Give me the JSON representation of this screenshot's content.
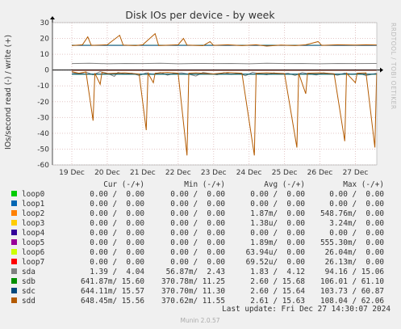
{
  "chart_data": {
    "type": "line",
    "title": "Disk IOs per device - by week",
    "ylabel": "IOs/second read (-) / write (+)",
    "ylim": [
      -60,
      30
    ],
    "yticks": [
      30,
      20,
      10,
      0,
      -10,
      -20,
      -30,
      -40,
      -50,
      -60
    ],
    "xlim": [
      "2024-12-19T00:00",
      "2024-12-27T14:30"
    ],
    "xticks": [
      {
        "label": "19 Dec",
        "time": "2024-12-19T00:00"
      },
      {
        "label": "20 Dec",
        "time": "2024-12-20T00:00"
      },
      {
        "label": "21 Dec",
        "time": "2024-12-21T00:00"
      },
      {
        "label": "22 Dec",
        "time": "2024-12-22T00:00"
      },
      {
        "label": "23 Dec",
        "time": "2024-12-23T00:00"
      },
      {
        "label": "24 Dec",
        "time": "2024-12-24T00:00"
      },
      {
        "label": "25 Dec",
        "time": "2024-12-25T00:00"
      },
      {
        "label": "26 Dec",
        "time": "2024-12-26T00:00"
      },
      {
        "label": "27 Dec",
        "time": "2024-12-27T00:00"
      }
    ],
    "grid": true,
    "legend_placement": "bottom",
    "series": [
      {
        "name": "loop0",
        "color": "#00cc00",
        "write_avg": 0,
        "read_avg": 0
      },
      {
        "name": "loop1",
        "color": "#0066b3",
        "write_avg": 0,
        "read_avg": 0
      },
      {
        "name": "loop2",
        "color": "#ff8000",
        "write_avg": 0,
        "read_avg": 0.00187
      },
      {
        "name": "loop3",
        "color": "#ffcc00",
        "write_avg": 0,
        "read_avg": 1.38e-06
      },
      {
        "name": "loop4",
        "color": "#330099",
        "write_avg": 0,
        "read_avg": 0
      },
      {
        "name": "loop5",
        "color": "#990099",
        "write_avg": 0,
        "read_avg": 0.00189
      },
      {
        "name": "loop6",
        "color": "#ccff00",
        "write_avg": 0,
        "read_avg": 6.394e-05
      },
      {
        "name": "loop7",
        "color": "#ff0000",
        "write_avg": 0,
        "read_avg": 6.952e-05
      },
      {
        "name": "sda",
        "color": "#808080",
        "write_avg": 4.12,
        "read_avg": 1.83,
        "write_points": [
          [
            0,
            4.1
          ],
          [
            0.5,
            4.3
          ],
          [
            1,
            4.0
          ],
          [
            1.5,
            4.2
          ],
          [
            2,
            4.1
          ],
          [
            2.5,
            4.3
          ],
          [
            3,
            4.0
          ],
          [
            3.5,
            4.2
          ],
          [
            4,
            4.1
          ],
          [
            4.5,
            4.2
          ],
          [
            5,
            4.0
          ],
          [
            5.5,
            4.3
          ],
          [
            6,
            4.1
          ],
          [
            6.5,
            4.2
          ],
          [
            7,
            4.0
          ],
          [
            7.5,
            4.2
          ],
          [
            8,
            4.1
          ],
          [
            8.6,
            4.2
          ]
        ],
        "read_points": [
          [
            0,
            -1.5
          ],
          [
            0.2,
            -2.5
          ],
          [
            0.4,
            -1.2
          ],
          [
            0.6,
            -3.0
          ],
          [
            0.8,
            -1.0
          ],
          [
            1,
            -2.0
          ],
          [
            1.2,
            -4.0
          ],
          [
            1.3,
            -1.5
          ],
          [
            1.5,
            -2.5
          ],
          [
            1.7,
            -2.0
          ],
          [
            1.9,
            -3.5
          ],
          [
            2.1,
            -1.8
          ],
          [
            2.3,
            -2.8
          ],
          [
            2.5,
            -1.5
          ],
          [
            2.7,
            -3.2
          ],
          [
            2.9,
            -2.0
          ],
          [
            3.1,
            -1.8
          ],
          [
            3.3,
            -2.6
          ],
          [
            3.5,
            -3.8
          ],
          [
            3.7,
            -1.5
          ],
          [
            3.9,
            -2.2
          ],
          [
            4.1,
            -3.0
          ],
          [
            4.3,
            -1.6
          ],
          [
            4.5,
            -2.8
          ],
          [
            4.7,
            -2.0
          ],
          [
            4.9,
            -3.6
          ],
          [
            5.1,
            -1.4
          ],
          [
            5.3,
            -2.4
          ],
          [
            5.5,
            -3.0
          ],
          [
            5.7,
            -1.8
          ],
          [
            5.9,
            -2.6
          ],
          [
            6.1,
            -2.0
          ],
          [
            6.3,
            -3.4
          ],
          [
            6.5,
            -1.6
          ],
          [
            6.7,
            -2.5
          ],
          [
            6.9,
            -3.1
          ],
          [
            7.1,
            -1.7
          ],
          [
            7.3,
            -2.4
          ],
          [
            7.5,
            -3.3
          ],
          [
            7.7,
            -1.9
          ],
          [
            7.9,
            -2.7
          ],
          [
            8.1,
            -2.0
          ],
          [
            8.3,
            -3.5
          ],
          [
            8.6,
            -2.0
          ]
        ]
      },
      {
        "name": "sdb",
        "color": "#008f00",
        "write_avg": 15.68,
        "read_avg": 2.6
      },
      {
        "name": "sdc",
        "color": "#00487d",
        "write_avg": 15.64,
        "read_avg": 2.6
      },
      {
        "name": "sdd",
        "color": "#b35a00",
        "write_avg": 15.63,
        "read_avg": 2.61,
        "write_points": [
          [
            0,
            15.5
          ],
          [
            0.3,
            16
          ],
          [
            0.45,
            21
          ],
          [
            0.55,
            15.6
          ],
          [
            1,
            16
          ],
          [
            1.35,
            22
          ],
          [
            1.45,
            15.8
          ],
          [
            1.8,
            15.5
          ],
          [
            2,
            16
          ],
          [
            2.35,
            23
          ],
          [
            2.45,
            15.5
          ],
          [
            3,
            16
          ],
          [
            3.15,
            20
          ],
          [
            3.25,
            15.8
          ],
          [
            3.7,
            15.4
          ],
          [
            3.9,
            18
          ],
          [
            4,
            15.6
          ],
          [
            4.4,
            16
          ],
          [
            4.8,
            15.5
          ],
          [
            5.2,
            16
          ],
          [
            5.5,
            15.2
          ],
          [
            5.9,
            15.8
          ],
          [
            6.3,
            15.5
          ],
          [
            6.6,
            16
          ],
          [
            6.95,
            18
          ],
          [
            7.05,
            15.6
          ],
          [
            7.5,
            16
          ],
          [
            8,
            15.8
          ],
          [
            8.3,
            16
          ],
          [
            8.6,
            15.9
          ]
        ],
        "read_points": [
          [
            0,
            -1
          ],
          [
            0.2,
            -2
          ],
          [
            0.4,
            -1.2
          ],
          [
            0.6,
            -32
          ],
          [
            0.65,
            -2
          ],
          [
            0.8,
            -9
          ],
          [
            0.85,
            -1.5
          ],
          [
            1,
            -2.2
          ],
          [
            1.5,
            -1.8
          ],
          [
            1.9,
            -2.5
          ],
          [
            2.1,
            -38
          ],
          [
            2.15,
            -2
          ],
          [
            2.3,
            -8
          ],
          [
            2.35,
            -2
          ],
          [
            2.7,
            -1.5
          ],
          [
            3.0,
            -2.0
          ],
          [
            3.25,
            -54
          ],
          [
            3.3,
            -2
          ],
          [
            3.5,
            -1.8
          ],
          [
            4.0,
            -2.4
          ],
          [
            4.4,
            -1.6
          ],
          [
            4.8,
            -2
          ],
          [
            5.15,
            -54
          ],
          [
            5.2,
            -2
          ],
          [
            5.5,
            -1.8
          ],
          [
            6.0,
            -2.2
          ],
          [
            6.35,
            -49
          ],
          [
            6.4,
            -2
          ],
          [
            6.6,
            -15
          ],
          [
            6.65,
            -2
          ],
          [
            7.0,
            -1.8
          ],
          [
            7.4,
            -2.3
          ],
          [
            7.7,
            -45
          ],
          [
            7.75,
            -2
          ],
          [
            8.0,
            -8
          ],
          [
            8.05,
            -2
          ],
          [
            8.3,
            -1.8
          ],
          [
            8.55,
            -49
          ],
          [
            8.6,
            -2
          ]
        ]
      }
    ]
  },
  "legend_header": {
    "cur": "Cur (-/+)",
    "min": "Min (-/+)",
    "avg": "Avg (-/+)",
    "max": "Max (-/+)"
  },
  "legend_rows": [
    {
      "name": "loop0",
      "color": "#00cc00",
      "cur": "0.00 /  0.00",
      "min": "0.00 /  0.00",
      "avg": "0.00 /  0.00",
      "max": "0.00 /  0.00"
    },
    {
      "name": "loop1",
      "color": "#0066b3",
      "cur": "0.00 /  0.00",
      "min": "0.00 /  0.00",
      "avg": "0.00 /  0.00",
      "max": "0.00 /  0.00"
    },
    {
      "name": "loop2",
      "color": "#ff8000",
      "cur": "0.00 /  0.00",
      "min": "0.00 /  0.00",
      "avg": "1.87m/  0.00",
      "max": "548.76m/  0.00"
    },
    {
      "name": "loop3",
      "color": "#ffcc00",
      "cur": "0.00 /  0.00",
      "min": "0.00 /  0.00",
      "avg": "1.38u/  0.00",
      "max": "3.24m/  0.00"
    },
    {
      "name": "loop4",
      "color": "#330099",
      "cur": "0.00 /  0.00",
      "min": "0.00 /  0.00",
      "avg": "0.00 /  0.00",
      "max": "0.00 /  0.00"
    },
    {
      "name": "loop5",
      "color": "#990099",
      "cur": "0.00 /  0.00",
      "min": "0.00 /  0.00",
      "avg": "1.89m/  0.00",
      "max": "555.30m/  0.00"
    },
    {
      "name": "loop6",
      "color": "#ccff00",
      "cur": "0.00 /  0.00",
      "min": "0.00 /  0.00",
      "avg": "63.94u/  0.00",
      "max": "26.04m/  0.00"
    },
    {
      "name": "loop7",
      "color": "#ff0000",
      "cur": "0.00 /  0.00",
      "min": "0.00 /  0.00",
      "avg": "69.52u/  0.00",
      "max": "26.13m/  0.00"
    },
    {
      "name": "sda",
      "color": "#808080",
      "cur": "1.39 /  4.04",
      "min": "56.87m/  2.43",
      "avg": "1.83 /  4.12",
      "max": "94.16 / 15.06"
    },
    {
      "name": "sdb",
      "color": "#008f00",
      "cur": "641.87m/ 15.60",
      "min": "370.78m/ 11.25",
      "avg": "2.60 / 15.68",
      "max": "106.01 / 61.10"
    },
    {
      "name": "sdc",
      "color": "#00487d",
      "cur": "644.11m/ 15.57",
      "min": "370.70m/ 11.30",
      "avg": "2.60 / 15.64",
      "max": "103.73 / 60.87"
    },
    {
      "name": "sdd",
      "color": "#b35a00",
      "cur": "648.45m/ 15.56",
      "min": "370.62m/ 11.55",
      "avg": "2.61 / 15.63",
      "max": "108.04 / 62.06"
    }
  ],
  "last_update": "Last update: Fri Dec 27 14:30:07 2024",
  "side_text": "RRDTOOL / TOBI OETIKER",
  "footer": "Munin 2.0.57"
}
